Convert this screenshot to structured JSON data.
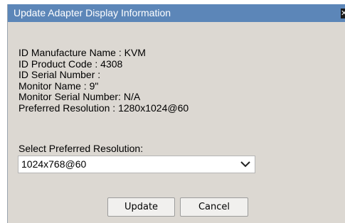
{
  "dialog": {
    "title": "Update Adapter Display Information",
    "close_icon": "close-icon"
  },
  "info": {
    "manufacture_name": "ID Manufacture Name : KVM",
    "product_code": "ID Product Code : 4308",
    "serial_number": "ID Serial Number :",
    "monitor_name": "Monitor Name : 9\"",
    "monitor_serial": "Monitor Serial Number: N/A",
    "preferred_resolution": "Preferred Resolution : 1280x1024@60"
  },
  "select": {
    "label": "Select Preferred Resolution:",
    "value": "1024x768@60",
    "arrow_icon": "chevron-down-icon"
  },
  "buttons": {
    "update": "Update",
    "cancel": "Cancel"
  }
}
